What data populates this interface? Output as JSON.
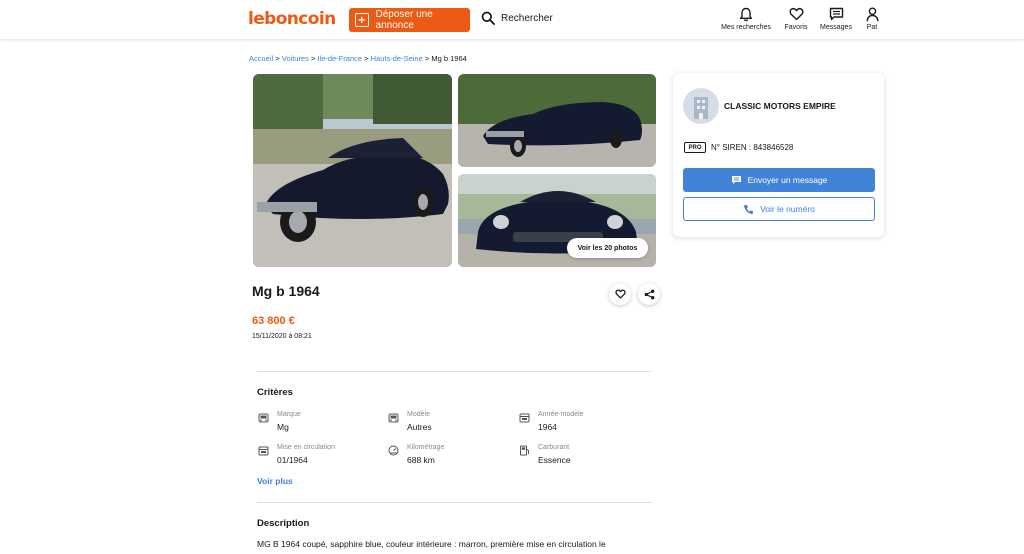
{
  "header": {
    "logo": "leboncoin",
    "post_ad_label": "Déposer une annonce",
    "search_label": "Rechercher",
    "nav": [
      {
        "label": "Mes recherches",
        "icon": "bell-icon"
      },
      {
        "label": "Favoris",
        "icon": "heart-icon"
      },
      {
        "label": "Messages",
        "icon": "message-icon"
      },
      {
        "label": "Pat",
        "icon": "user-icon"
      }
    ]
  },
  "breadcrumb": {
    "items": [
      "Accueil",
      "Voitures",
      "Ile-de-France",
      "Hauts-de-Seine"
    ],
    "separator": ">",
    "current": "Mg b 1964"
  },
  "gallery": {
    "see_all_label": "Voir les 20 photos"
  },
  "ad": {
    "title": "Mg b 1964",
    "price": "63 800 €",
    "date": "15/11/2020 à 08:21"
  },
  "criteria": {
    "title": "Critères",
    "items": [
      {
        "label": "Marque",
        "value": "Mg",
        "icon": "car-icon"
      },
      {
        "label": "Modèle",
        "value": "Autres",
        "icon": "car-icon"
      },
      {
        "label": "Année-modèle",
        "value": "1964",
        "icon": "calendar-icon"
      },
      {
        "label": "Mise en circulation",
        "value": "01/1964",
        "icon": "calendar-icon"
      },
      {
        "label": "Kilométrage",
        "value": "688 km",
        "icon": "gauge-icon"
      },
      {
        "label": "Carburant",
        "value": "Essence",
        "icon": "fuel-icon"
      }
    ],
    "see_more_label": "Voir plus"
  },
  "description": {
    "title": "Description",
    "text": "MG B 1964 coupé, sapphire blue, couleur intérieure : marron, première mise en circulation le"
  },
  "seller": {
    "name": "CLASSIC MOTORS EMPIRE",
    "badge": "PRO",
    "siren": "N° SIREN : 843846528",
    "message_label": "Envoyer un message",
    "phone_label": "Voir le numéro"
  },
  "colors": {
    "brand_orange": "#ec5a13",
    "link_blue": "#4183d7"
  }
}
